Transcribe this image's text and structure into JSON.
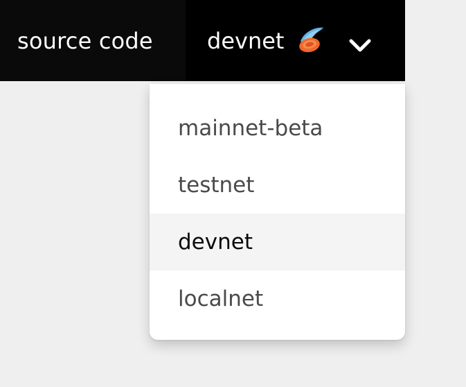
{
  "navbar": {
    "source_code_label": "source code",
    "network": {
      "selected_label": "devnet",
      "logo_icon": "solana-flying-disc-icon",
      "chevron_icon": "chevron-down-icon"
    }
  },
  "dropdown": {
    "items": [
      {
        "label": "mainnet-beta"
      },
      {
        "label": "testnet"
      },
      {
        "label": "devnet",
        "active": true
      },
      {
        "label": "localnet"
      }
    ]
  },
  "colors": {
    "navbar_bg": "#0a0a0a",
    "network_bg": "#000000",
    "page_bg": "#efefef",
    "active_item_bg": "#f4f4f4",
    "logo_orange": "#f0672d",
    "logo_blue": "#63b4e6"
  }
}
